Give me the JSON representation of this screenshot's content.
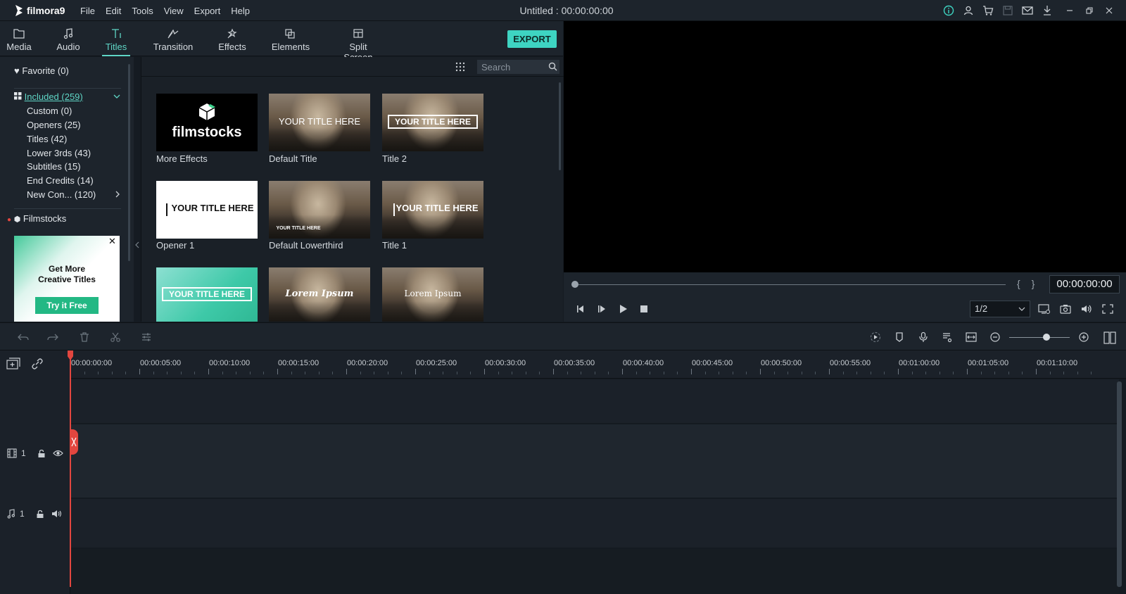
{
  "app": {
    "logo_text": "filmora9",
    "menu": [
      "File",
      "Edit",
      "Tools",
      "View",
      "Export",
      "Help"
    ],
    "document_title": "Untitled : 00:00:00:00"
  },
  "library_tabs": [
    {
      "label": "Media",
      "icon": "folder-icon"
    },
    {
      "label": "Audio",
      "icon": "music-note-icon"
    },
    {
      "label": "Titles",
      "icon": "text-icon",
      "active": true
    },
    {
      "label": "Transition",
      "icon": "transition-icon"
    },
    {
      "label": "Effects",
      "icon": "effects-icon"
    },
    {
      "label": "Elements",
      "icon": "elements-icon"
    },
    {
      "label": "Split Screen",
      "icon": "split-screen-icon"
    }
  ],
  "export_label": "EXPORT",
  "sidebar": {
    "favorite": "Favorite (0)",
    "included": "Included (259)",
    "subcategories": [
      "Custom (0)",
      "Openers (25)",
      "Titles (42)",
      "Lower 3rds (43)",
      "Subtitles (15)",
      "End Credits (14)",
      "New Con... (120)"
    ],
    "filmstocks": "Filmstocks"
  },
  "ad": {
    "line1": "Get More",
    "line2": "Creative Titles",
    "button": "Try it Free",
    "close": "✕"
  },
  "search": {
    "placeholder": "Search"
  },
  "tiles": {
    "filmstocks_brand": "filmstocks",
    "your_title_here": "YOUR TITLE HERE",
    "lorem_ipsum": "Lorem Ipsum",
    "labels": [
      "More Effects",
      "Default Title",
      "Title 2",
      "Opener 1",
      "Default Lowerthird",
      "Title 1"
    ]
  },
  "preview": {
    "timecode": "00:00:00:00",
    "quality": "1/2",
    "braces": "{ }"
  },
  "timeline": {
    "ruler": [
      "00:00:00:00",
      "00:00:05:00",
      "00:00:10:00",
      "00:00:15:00",
      "00:00:20:00",
      "00:00:25:00",
      "00:00:30:00",
      "00:00:35:00",
      "00:00:40:00",
      "00:00:45:00",
      "00:00:50:00",
      "00:00:55:00",
      "00:01:00:00",
      "00:01:05:00",
      "00:01:10:00"
    ],
    "video_track": "1",
    "audio_track": "1"
  },
  "colors": {
    "accent": "#3ed4c2",
    "playhead": "#e2463f"
  }
}
